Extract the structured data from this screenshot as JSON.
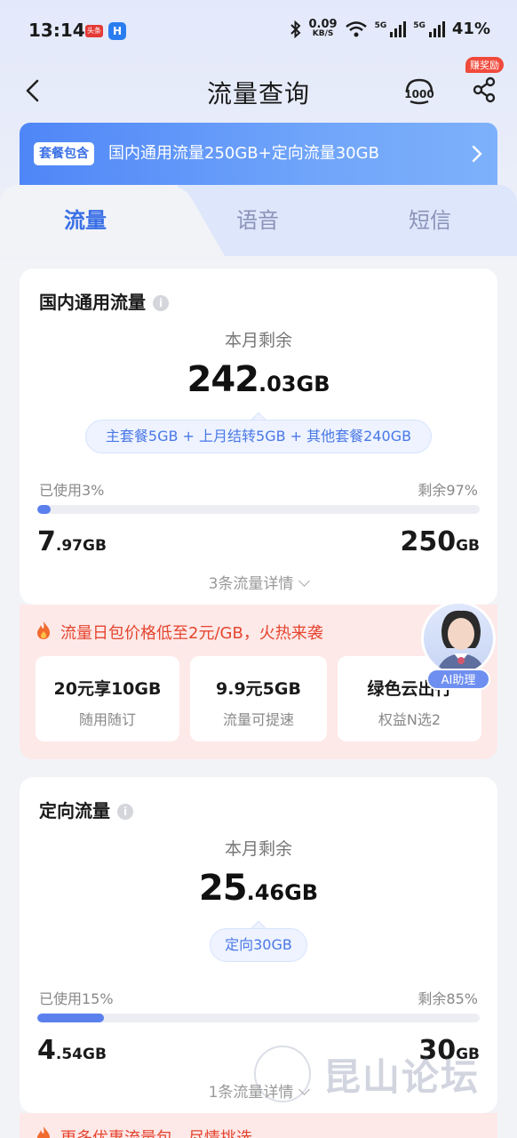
{
  "status_bar": {
    "time": "13:14",
    "app1": "头条",
    "app2": "H",
    "speed_value": "0.09",
    "speed_unit": "KB/S",
    "net1": "5G",
    "net2": "5G",
    "battery": "41%"
  },
  "header": {
    "title": "流量查询",
    "reward_badge": "赚奖励",
    "icons": [
      "back-icon",
      "10000-icon",
      "share-icon"
    ]
  },
  "package_banner": {
    "tag": "套餐包含",
    "text": "国内通用流量250GB+定向流量30GB"
  },
  "tabs": [
    {
      "label": "流量",
      "active": true
    },
    {
      "label": "语音",
      "active": false
    },
    {
      "label": "短信",
      "active": false
    }
  ],
  "general_data": {
    "title": "国内通用流量",
    "remain_label": "本月剩余",
    "remain_int": "242",
    "remain_dec": ".03GB",
    "breakdown": "主套餐5GB + 上月结转5GB + 其他套餐240GB",
    "used_label": "已使用3%",
    "left_label": "剩余97%",
    "used_fraction": 0.03,
    "used_int": "7",
    "used_dec": ".97GB",
    "total_int": "250",
    "total_unit": "GB",
    "detail_link": "3条流量详情"
  },
  "promo": {
    "text": "流量日包价格低至2元/GB，火热来袭",
    "tiles": [
      {
        "title": "20元享10GB",
        "sub": "随用随订"
      },
      {
        "title": "9.9元5GB",
        "sub": "流量可提速"
      },
      {
        "title": "绿色云出行",
        "sub": "权益N选2"
      }
    ]
  },
  "ai_assistant": {
    "label": "AI助理"
  },
  "directed_data": {
    "title": "定向流量",
    "remain_label": "本月剩余",
    "remain_int": "25",
    "remain_dec": ".46GB",
    "breakdown": "定向30GB",
    "used_label": "已使用15%",
    "left_label": "剩余85%",
    "used_fraction": 0.15,
    "used_int": "4",
    "used_dec": ".54GB",
    "total_int": "30",
    "total_unit": "GB",
    "detail_link": "1条流量详情"
  },
  "promo2": {
    "text": "更多优惠流量包，尽情挑选"
  },
  "watermark": {
    "text": "昆山论坛"
  },
  "colors": {
    "accent": "#3a6fe6",
    "progress": "#5b80ee",
    "promo_text": "#e5452f",
    "promo_bg": "#fde9e8"
  }
}
